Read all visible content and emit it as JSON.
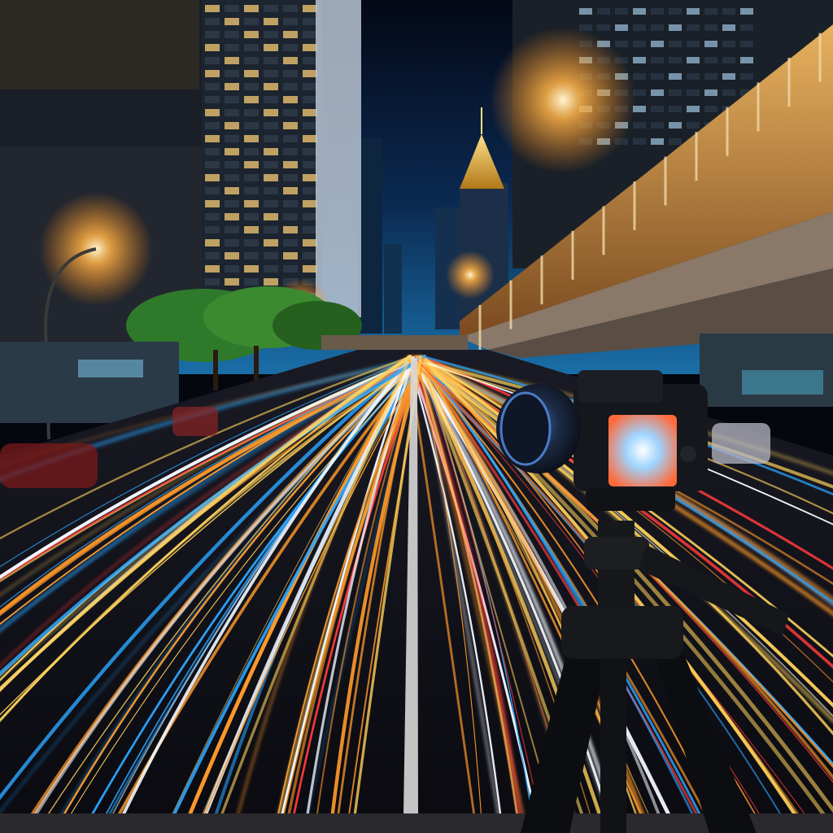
{
  "scene": {
    "subject": "long-exposure-night-street-with-camera-on-tripod"
  },
  "palette": {
    "sky_top": "#040816",
    "sky_mid": "#0b2a52",
    "sky_glow": "#1a6fa8",
    "streetlight": "#ffb347",
    "trail_orange": "#ff9a2a",
    "trail_yellow": "#ffd35c",
    "trail_red": "#ff3b3b",
    "trail_blue": "#2aa6ff",
    "trail_white": "#f4f8ff",
    "camera_body": "#14171c",
    "bridge_warm": "#e0a552",
    "tree_green": "#2f7a2a"
  }
}
